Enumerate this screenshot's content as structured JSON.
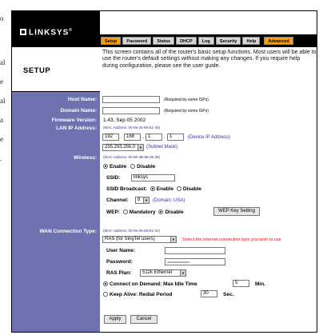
{
  "doc_fragments": [
    "o",
    "al",
    "e",
    "al",
    "a",
    "e",
    "."
  ],
  "brand": "LINKSYS",
  "brand_mark": "®",
  "tabs": [
    {
      "label": "Setup",
      "active": true
    },
    {
      "label": "Password"
    },
    {
      "label": "Status"
    },
    {
      "label": "DHCP"
    },
    {
      "label": "Log"
    },
    {
      "label": "Security"
    },
    {
      "label": "Help"
    }
  ],
  "advanced_tab": "Advanced",
  "section_title": "SETUP",
  "description": "This screen contains all of the router's basic setup functions. Most users will be able to use the router's default settings without making any changes. If you require help during configuration, please see the user guide.",
  "host_name": {
    "label": "Host Name:",
    "value": "",
    "note": "(Required by some ISPs)"
  },
  "domain_name": {
    "label": "Domain Name:",
    "value": "",
    "note": "(Required by some ISPs)"
  },
  "firmware": {
    "label": "Firmware Version:",
    "value": "1.43, Sep 05 2002"
  },
  "lan": {
    "label": "LAN IP Address:",
    "mac": "(MAC Address: 00-06-25-69-E1-30)",
    "ip": [
      "192",
      "168",
      "1",
      "1"
    ],
    "ip_note": "(Device IP Address)",
    "mask": "255.255.255.0",
    "mask_note": "(Subnet Mask)"
  },
  "wireless": {
    "label": "Wireless:",
    "mac": "(MAC Address: 00-90-4B-89-39-39)",
    "enable": "Enable",
    "disable": "Disable",
    "ssid_label": "SSID:",
    "ssid": "linksys",
    "broadcast_label": "SSID Broadcast:",
    "channel_label": "Channel:",
    "channel": "6",
    "domain_note": "(Domain: USA)",
    "wep_label": "WEP:",
    "mandatory": "Mandatory",
    "wep_button": "WEP Key Setting"
  },
  "wan": {
    "label": "WAN Connection Type:",
    "mac": "(MAC Address: 00-06-25-69-E1-31)",
    "type": "RAS (for SingTel users)",
    "hint": "Select the internet connection type you wish to use",
    "user_label": "User Name:",
    "user": "",
    "pass_label": "Password:",
    "pass": "••••••••••••••••••••",
    "plan_label": "RAS Plan:",
    "plan": "512k Ethernet",
    "cod": "Connect on Demand: Max Idle Time",
    "idle": "5",
    "min": "Min.",
    "keep": "Keep Alive: Redial Period",
    "redial": "30",
    "sec": "Sec."
  },
  "buttons": {
    "apply": "Apply",
    "cancel": "Cancel"
  }
}
